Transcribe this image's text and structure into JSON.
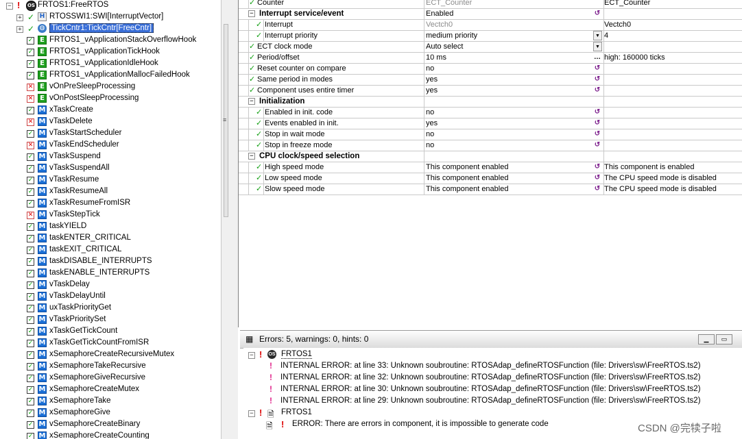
{
  "tree": {
    "items": [
      {
        "label": "FRTOS1:FreeRTOS",
        "exp": "⊟",
        "state": "bang",
        "icon": "os",
        "level": 0
      },
      {
        "label": "RTOSSWI1:SWI[InterruptVector]",
        "exp": "⊞",
        "state": "tick",
        "icon": "hh",
        "level": 1
      },
      {
        "label": "TickCntr1:TickCntr[FreeCntr]",
        "exp": "⊞",
        "state": "tick",
        "icon": "globe",
        "level": 1,
        "selected": true
      },
      {
        "label": "FRTOS1_vApplicationStackOverflowHook",
        "state": "on",
        "icon": "e",
        "level": 2
      },
      {
        "label": "FRTOS1_vApplicationTickHook",
        "state": "on",
        "icon": "e",
        "level": 2
      },
      {
        "label": "FRTOS1_vApplicationIdleHook",
        "state": "on",
        "icon": "e",
        "level": 2
      },
      {
        "label": "FRTOS1_vApplicationMallocFailedHook",
        "state": "on",
        "icon": "e",
        "level": 2
      },
      {
        "label": "vOnPreSleepProcessing",
        "state": "off",
        "icon": "e",
        "level": 2
      },
      {
        "label": "vOnPostSleepProcessing",
        "state": "off",
        "icon": "e",
        "level": 2
      },
      {
        "label": "xTaskCreate",
        "state": "on",
        "icon": "m",
        "level": 2
      },
      {
        "label": "vTaskDelete",
        "state": "off",
        "icon": "m",
        "level": 2
      },
      {
        "label": "vTaskStartScheduler",
        "state": "on",
        "icon": "m",
        "level": 2
      },
      {
        "label": "vTaskEndScheduler",
        "state": "off",
        "icon": "m",
        "level": 2
      },
      {
        "label": "vTaskSuspend",
        "state": "on",
        "icon": "m",
        "level": 2
      },
      {
        "label": "vTaskSuspendAll",
        "state": "on",
        "icon": "m",
        "level": 2
      },
      {
        "label": "vTaskResume",
        "state": "on",
        "icon": "m",
        "level": 2
      },
      {
        "label": "xTaskResumeAll",
        "state": "on",
        "icon": "m",
        "level": 2
      },
      {
        "label": "xTaskResumeFromISR",
        "state": "on",
        "icon": "m",
        "level": 2
      },
      {
        "label": "vTaskStepTick",
        "state": "off",
        "icon": "m",
        "level": 2
      },
      {
        "label": "taskYIELD",
        "state": "on",
        "icon": "m",
        "level": 2
      },
      {
        "label": "taskENTER_CRITICAL",
        "state": "on",
        "icon": "m",
        "level": 2
      },
      {
        "label": "taskEXIT_CRITICAL",
        "state": "on",
        "icon": "m",
        "level": 2
      },
      {
        "label": "taskDISABLE_INTERRUPTS",
        "state": "on",
        "icon": "m",
        "level": 2
      },
      {
        "label": "taskENABLE_INTERRUPTS",
        "state": "on",
        "icon": "m",
        "level": 2
      },
      {
        "label": "vTaskDelay",
        "state": "on",
        "icon": "m",
        "level": 2
      },
      {
        "label": "vTaskDelayUntil",
        "state": "on",
        "icon": "m",
        "level": 2
      },
      {
        "label": "uxTaskPriorityGet",
        "state": "on",
        "icon": "m",
        "level": 2
      },
      {
        "label": "vTaskPrioritySet",
        "state": "on",
        "icon": "m",
        "level": 2
      },
      {
        "label": "xTaskGetTickCount",
        "state": "on",
        "icon": "m",
        "level": 2
      },
      {
        "label": "xTaskGetTickCountFromISR",
        "state": "on",
        "icon": "m",
        "level": 2
      },
      {
        "label": "xSemaphoreCreateRecursiveMutex",
        "state": "on",
        "icon": "m",
        "level": 2
      },
      {
        "label": "xSemaphoreTakeRecursive",
        "state": "on",
        "icon": "m",
        "level": 2
      },
      {
        "label": "xSemaphoreGiveRecursive",
        "state": "on",
        "icon": "m",
        "level": 2
      },
      {
        "label": "xSemaphoreCreateMutex",
        "state": "on",
        "icon": "m",
        "level": 2
      },
      {
        "label": "xSemaphoreTake",
        "state": "on",
        "icon": "m",
        "level": 2
      },
      {
        "label": "xSemaphoreGive",
        "state": "on",
        "icon": "m",
        "level": 2
      },
      {
        "label": "vSemaphoreCreateBinary",
        "state": "on",
        "icon": "m",
        "level": 2
      },
      {
        "label": "xSemaphoreCreateCounting",
        "state": "on",
        "icon": "m",
        "level": 2
      }
    ]
  },
  "grid": {
    "rows": [
      {
        "name": "Counter",
        "value": "ECT_Counter",
        "gray": true,
        "detail": "ECT_Counter",
        "kind": "top"
      },
      {
        "name": "Interrupt service/event",
        "value": "Enabled",
        "ctrl": "reset",
        "kind": "grp",
        "exp": "⊟"
      },
      {
        "name": "Interrupt",
        "value": "Vectch0",
        "gray": true,
        "detail": "Vectch0",
        "kind": "sub"
      },
      {
        "name": "Interrupt priority",
        "value": "medium priority",
        "ctrl": "drop",
        "detail": "4",
        "kind": "sub"
      },
      {
        "name": "ECT clock mode",
        "value": "Auto select",
        "ctrl": "drop",
        "kind": "top"
      },
      {
        "name": "Period/offset",
        "value": "10 ms",
        "ctrl": "dots",
        "detail": "high: 160000 ticks",
        "kind": "top"
      },
      {
        "name": "Reset counter on compare",
        "value": "no",
        "ctrl": "reset",
        "kind": "top"
      },
      {
        "name": "Same period in modes",
        "value": "yes",
        "ctrl": "reset",
        "kind": "top"
      },
      {
        "name": "Component uses entire timer",
        "value": "yes",
        "ctrl": "reset",
        "kind": "top"
      },
      {
        "name": "Initialization",
        "value": "",
        "kind": "grp",
        "exp": "⊟"
      },
      {
        "name": "Enabled in init. code",
        "value": "no",
        "ctrl": "reset",
        "kind": "sub"
      },
      {
        "name": "Events enabled in init.",
        "value": "yes",
        "ctrl": "reset",
        "kind": "sub"
      },
      {
        "name": "Stop in wait mode",
        "value": "no",
        "ctrl": "reset",
        "kind": "sub"
      },
      {
        "name": "Stop in freeze mode",
        "value": "no",
        "ctrl": "reset",
        "kind": "sub"
      },
      {
        "name": "CPU clock/speed selection",
        "value": "",
        "kind": "grp",
        "exp": "⊟"
      },
      {
        "name": "High speed mode",
        "value": "This component enabled",
        "ctrl": "reset",
        "detail": "This component is enabled",
        "kind": "sub"
      },
      {
        "name": "Low speed mode",
        "value": "This component enabled",
        "ctrl": "reset",
        "detail": "The CPU speed mode is disabled",
        "kind": "sub"
      },
      {
        "name": "Slow speed mode",
        "value": "This component enabled",
        "ctrl": "reset",
        "detail": "The CPU speed mode is disabled",
        "kind": "sub"
      }
    ]
  },
  "errors": {
    "title": "Errors: 5, warnings: 0, hints: 0",
    "items": [
      {
        "kind": "comp",
        "exp": "⊟",
        "label": "FRTOS1",
        "level": 0,
        "icon": "os"
      },
      {
        "kind": "msg",
        "label": "INTERNAL ERROR: at line 33: Unknown soubroutine: RTOSAdap_defineRTOSFunction (file: Drivers\\sw\\FreeRTOS.ts2)",
        "level": 1
      },
      {
        "kind": "msg",
        "label": "INTERNAL ERROR: at line 32: Unknown soubroutine: RTOSAdap_defineRTOSFunction (file: Drivers\\sw\\FreeRTOS.ts2)",
        "level": 1
      },
      {
        "kind": "msg",
        "label": "INTERNAL ERROR: at line 30: Unknown soubroutine: RTOSAdap_defineRTOSFunction (file: Drivers\\sw\\FreeRTOS.ts2)",
        "level": 1
      },
      {
        "kind": "msg",
        "label": "INTERNAL ERROR: at line 29: Unknown soubroutine: RTOSAdap_defineRTOSFunction (file: Drivers\\sw\\FreeRTOS.ts2)",
        "level": 1
      },
      {
        "kind": "comp",
        "exp": "⊟",
        "label": "FRTOS1",
        "level": 0,
        "icon": "doc"
      },
      {
        "kind": "err",
        "label": "ERROR: There are errors in component, it is impossible to generate code",
        "level": 1
      }
    ]
  },
  "watermark": "CSDN @完犊子啦"
}
